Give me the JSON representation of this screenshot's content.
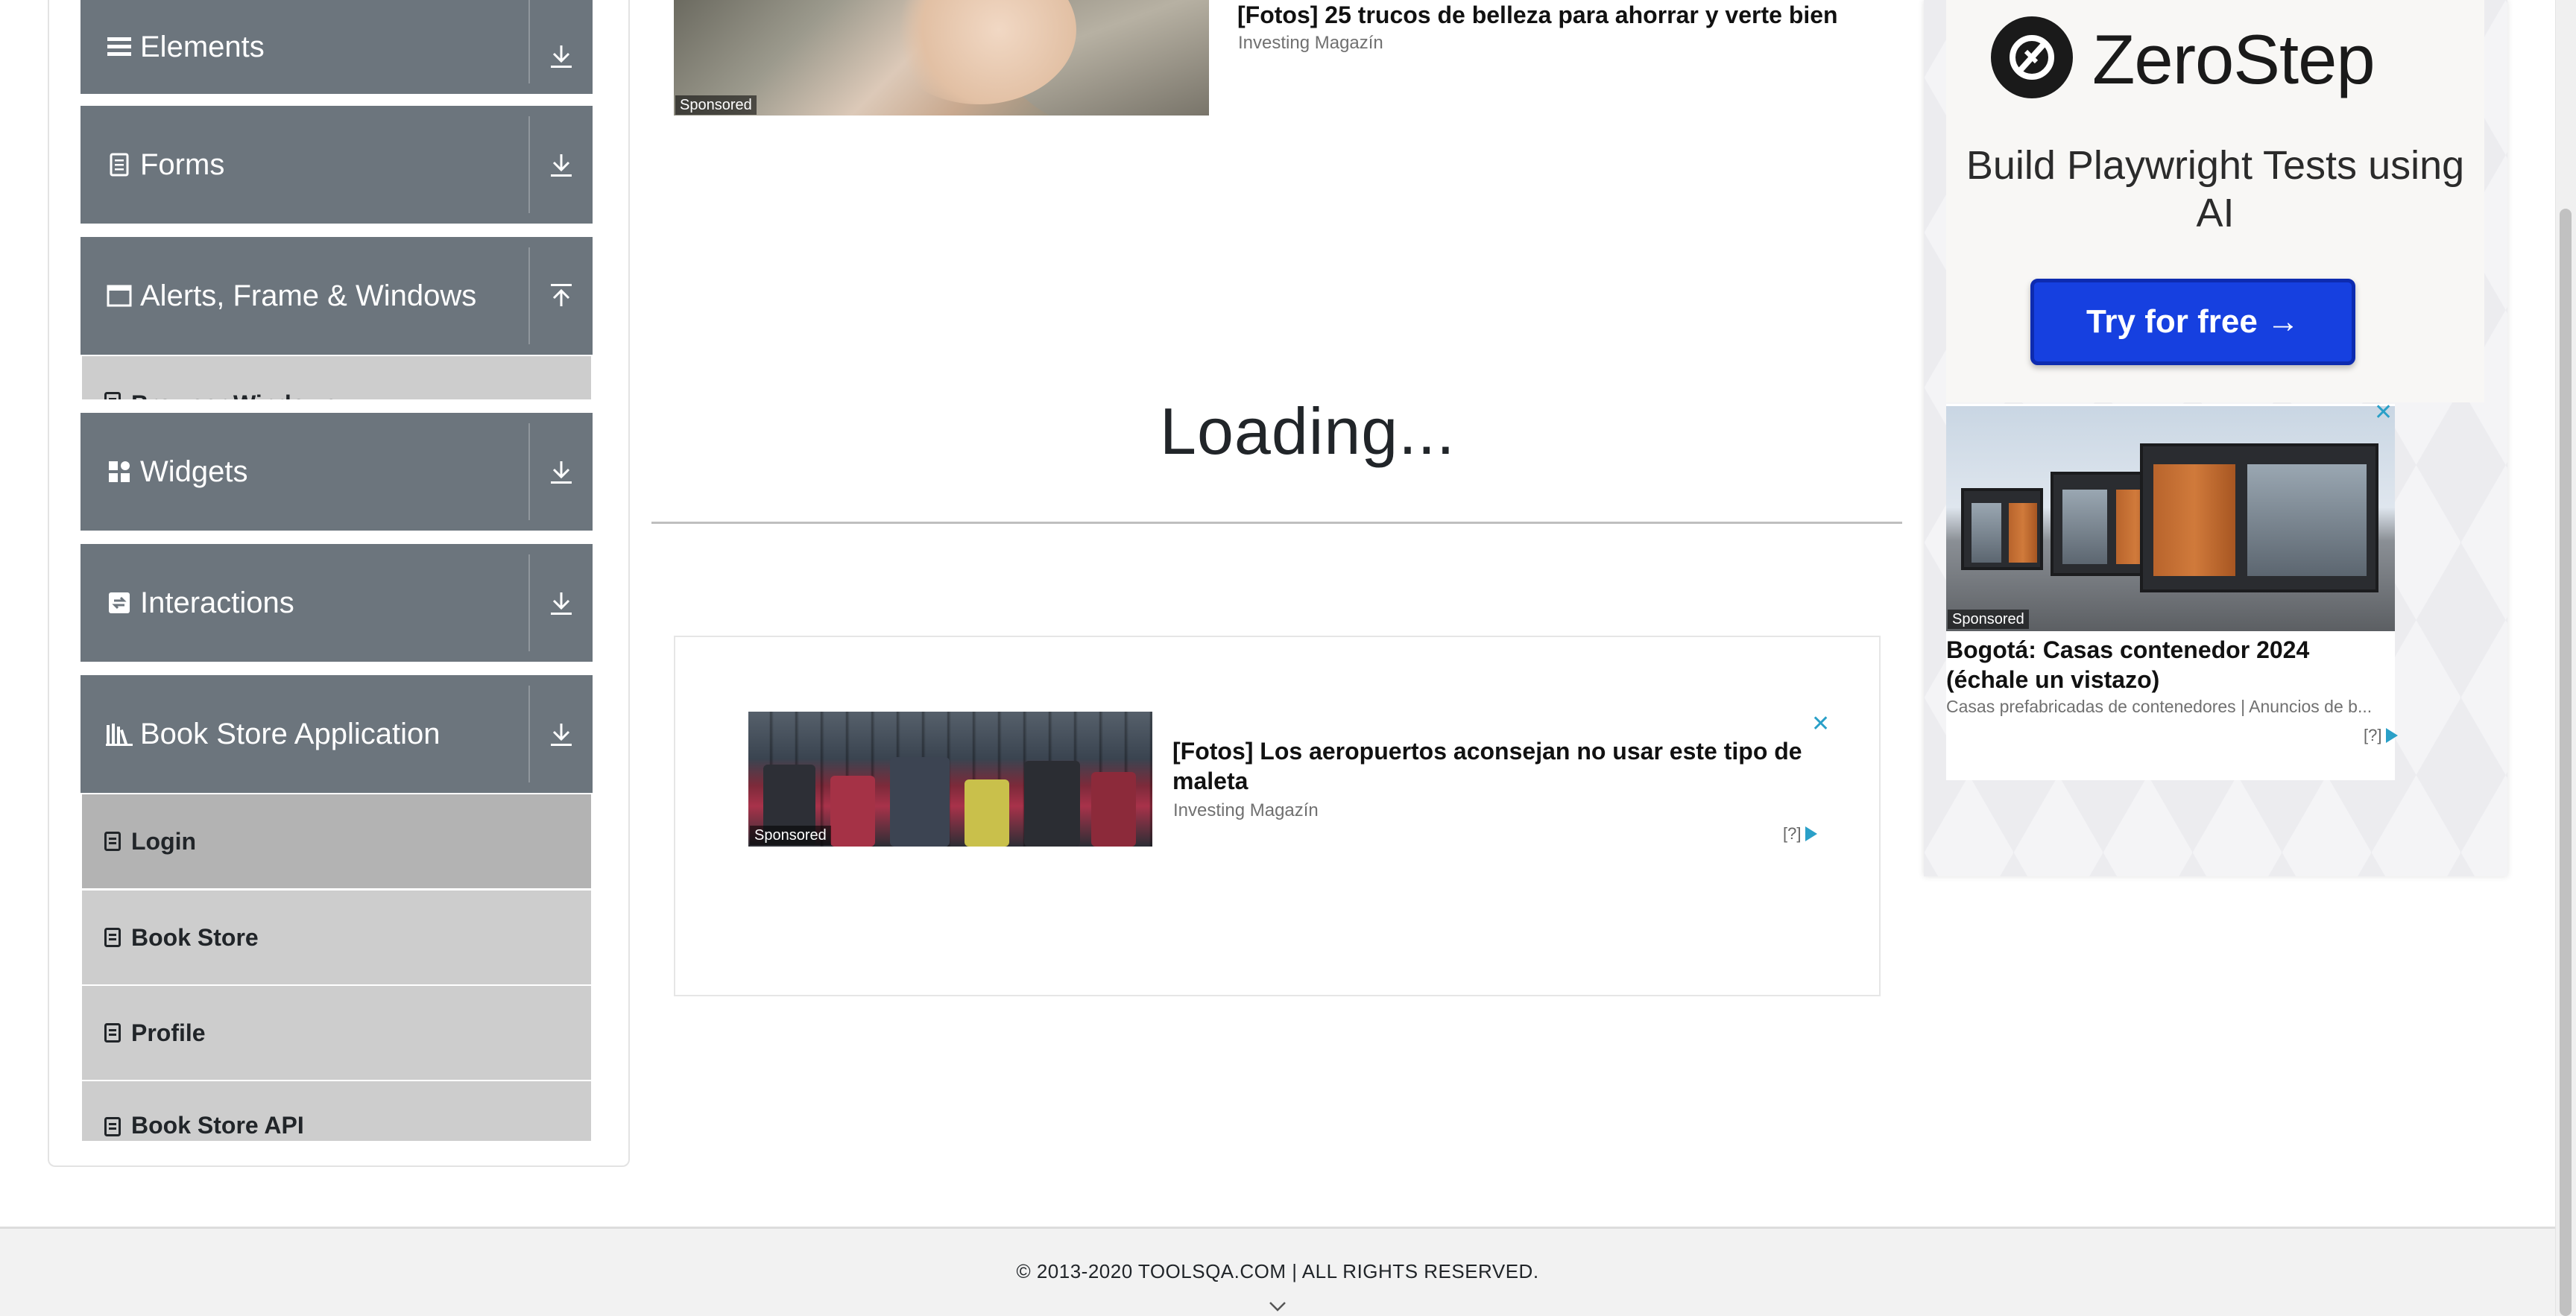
{
  "sidebar": {
    "groups": [
      {
        "title": "Elements",
        "icon": "hamburger-icon",
        "toggle": "download-icon"
      },
      {
        "title": "Forms",
        "icon": "form-icon",
        "toggle": "download-icon"
      },
      {
        "title": "Alerts, Frame & Windows",
        "icon": "window-icon",
        "toggle": "upload-icon"
      },
      {
        "title": "Widgets",
        "icon": "widgets-icon",
        "toggle": "download-icon"
      },
      {
        "title": "Interactions",
        "icon": "interactions-icon",
        "toggle": "download-icon"
      },
      {
        "title": "Book Store Application",
        "icon": "bookstore-icon",
        "toggle": "download-icon"
      }
    ],
    "alerts_partial_item": "Browser Windows",
    "bookstore_items": [
      "Login",
      "Book Store",
      "Profile",
      "Book Store API"
    ],
    "active_item": "Login"
  },
  "ad_top": {
    "sponsored": "Sponsored",
    "title": "[Fotos] 25 trucos de belleza para ahorrar y verte bien",
    "source": "Investing Magazín"
  },
  "main": {
    "loading_text": "Loading..."
  },
  "ad_middle": {
    "sponsored": "Sponsored",
    "title": "[Fotos] Los aeropuertos aconsejan no usar este tipo de maleta",
    "source": "Investing Magazín",
    "close": "✕",
    "adchoice": "[?]"
  },
  "right_ad": {
    "brand": "ZeroStep",
    "tagline": "Build Playwright Tests using AI",
    "cta": "Try for free →",
    "ad2": {
      "sponsored": "Sponsored",
      "title": "Bogotá: Casas contenedor 2024 (échale un vistazo)",
      "source": "Casas prefabricadas de contenedores | Anuncios de b...",
      "close": "✕",
      "adchoice": "[?]"
    }
  },
  "footer": {
    "copyright": "© 2013-2020 TOOLSQA.COM | ALL RIGHTS RESERVED."
  },
  "colors": {
    "group_header_bg": "#6c757d",
    "sub_item_bg": "#cdcdcd",
    "sub_item_active_bg": "#b3b3b3",
    "cta_blue": "#1640e0",
    "adchoice_blue": "#2aa0c8"
  }
}
